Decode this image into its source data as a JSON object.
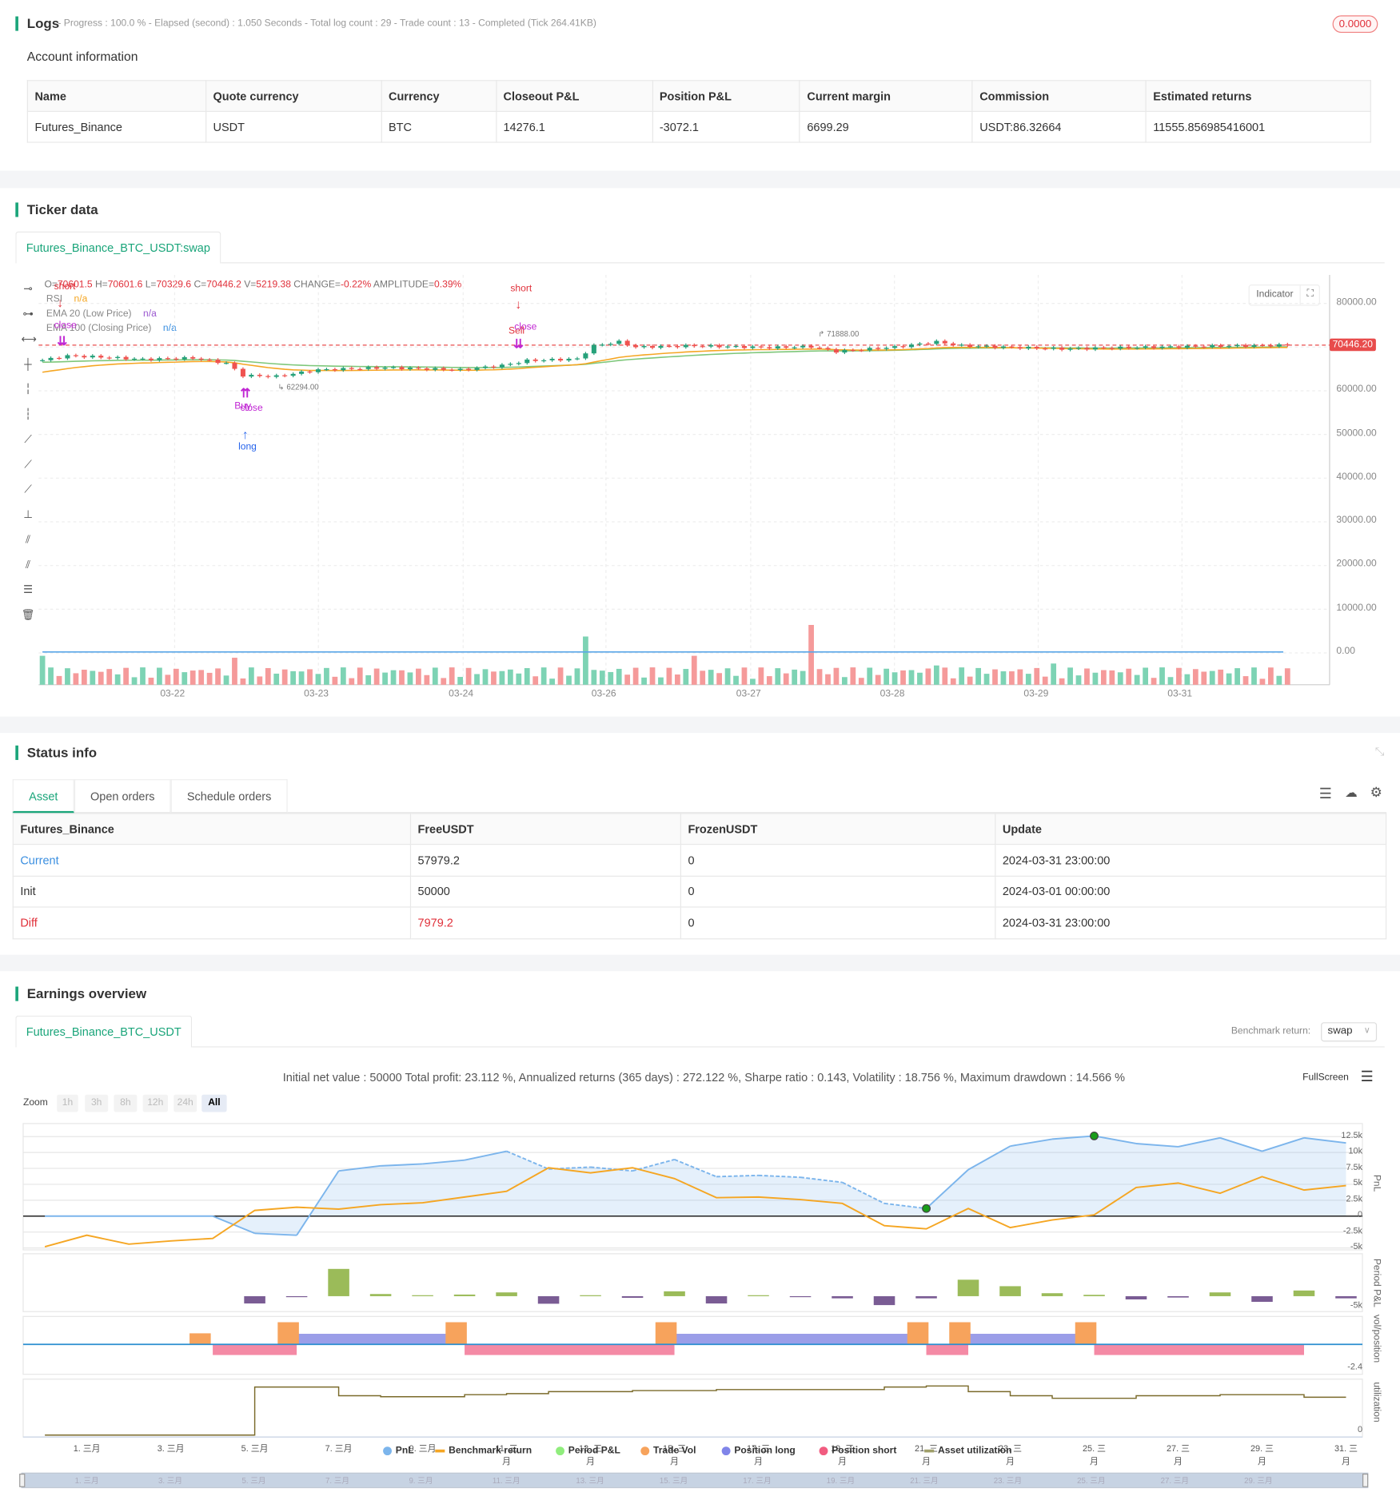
{
  "logs": {
    "title": "Logs",
    "summary": "- Progress : 100.0 % - Elapsed (second) : 1.050  Seconds - Total log count : 29 - Trade count : 13 - Completed (Tick 264.41KB)",
    "badge": "0.0000"
  },
  "account": {
    "title": "Account information",
    "headers": [
      "Name",
      "Quote currency",
      "Currency",
      "Closeout P&L",
      "Position P&L",
      "Current margin",
      "Commission",
      "Estimated returns"
    ],
    "row": [
      "Futures_Binance",
      "USDT",
      "BTC",
      "14276.1",
      "-3072.1",
      "6699.29",
      "USDT:86.32664",
      "11555.856985416001"
    ]
  },
  "ticker": {
    "title": "Ticker data",
    "tab": "Futures_Binance_BTC_USDT:swap",
    "ohlc": {
      "o_label": "O=",
      "o": "70601.5",
      "h_label": "H=",
      "h": "70601.6",
      "l_label": "L=",
      "l": "70329.6",
      "c_label": "C=",
      "c": "70446.2",
      "v_label": "V=",
      "v": "5219.38",
      "change_label": "CHANGE=",
      "change": "-0.22%",
      "amp_label": "AMPLITUDE=",
      "amp": "0.39%"
    },
    "indicators": [
      {
        "name": "RSI",
        "value": "n/a",
        "color": "#f5a623"
      },
      {
        "name": "EMA 20 (Low Price)",
        "value": "n/a",
        "color": "#9b59d0"
      },
      {
        "name": "EMA 100 (Closing Price)",
        "value": "n/a",
        "color": "#3b8fe0"
      }
    ],
    "indicator_button": "Indicator",
    "last_price": "70446.20",
    "high_mark": "71888.00",
    "low_mark": "62294.00",
    "yticks": [
      "80000.00",
      "60000.00",
      "50000.00",
      "40000.00",
      "30000.00",
      "20000.00",
      "10000.00",
      "0.00"
    ],
    "xticks": [
      "03-22",
      "03-23",
      "03-24",
      "03-26",
      "03-27",
      "03-28",
      "03-29",
      "03-31"
    ],
    "signals": [
      {
        "text": "short",
        "color": "#e0303a"
      },
      {
        "text": "close",
        "color": "#c026d3"
      },
      {
        "text": "Sell",
        "color": "#e0303a"
      },
      {
        "text": "short",
        "color": "#e0303a"
      },
      {
        "text": "close",
        "color": "#c026d3"
      },
      {
        "text": "Buy",
        "color": "#c026d3"
      },
      {
        "text": "close",
        "color": "#c026d3"
      },
      {
        "text": "long",
        "color": "#2563eb"
      }
    ]
  },
  "chart_data": [
    {
      "type": "candlestick",
      "title": "Futures_Binance_BTC_USDT:swap",
      "ylim": [
        0,
        85000
      ],
      "price_keyframes": [
        [
          0,
          67000
        ],
        [
          3,
          68000
        ],
        [
          6,
          67800
        ],
        [
          12,
          67200
        ],
        [
          18,
          67500
        ],
        [
          22,
          66300
        ],
        [
          24,
          63500
        ],
        [
          28,
          63300
        ],
        [
          33,
          64800
        ],
        [
          41,
          65300
        ],
        [
          50,
          64800
        ],
        [
          55,
          65800
        ],
        [
          58,
          66900
        ],
        [
          64,
          67300
        ],
        [
          66,
          70300
        ],
        [
          69,
          71200
        ],
        [
          71,
          70000
        ],
        [
          78,
          70300
        ],
        [
          87,
          69900
        ],
        [
          92,
          70100
        ],
        [
          95,
          69000
        ],
        [
          102,
          70000
        ],
        [
          107,
          71200
        ],
        [
          110,
          70300
        ],
        [
          122,
          69600
        ],
        [
          133,
          70000
        ],
        [
          149,
          70446.2
        ]
      ],
      "candle_count": 150,
      "volume_spikes": [
        [
          0,
          30
        ],
        [
          23,
          28
        ],
        [
          65,
          50
        ],
        [
          78,
          30
        ],
        [
          92,
          62
        ],
        [
          107,
          20
        ],
        [
          121,
          22
        ]
      ]
    },
    {
      "type": "line",
      "title": "PnL",
      "yticks": [
        "12.5k",
        "10k",
        "7.5k",
        "5k",
        "2.5k",
        "0",
        "-2.5k",
        "-5k"
      ],
      "ylim": [
        -5,
        12.5
      ],
      "x_days": [
        0,
        4,
        5,
        6,
        7,
        8,
        9,
        10,
        11,
        12,
        13,
        14,
        15,
        16,
        17,
        18,
        19,
        20,
        21,
        22,
        23,
        24,
        25,
        26,
        27,
        28,
        29,
        30,
        31
      ],
      "pnl_k": [
        0,
        0,
        -2.7,
        -3.0,
        7.1,
        7.9,
        8.2,
        8.8,
        10.2,
        7.4,
        7.7,
        7.1,
        8.9,
        6.2,
        6.4,
        6.1,
        5.3,
        2.0,
        1.2,
        7.3,
        11.0,
        12.1,
        12.6,
        11.4,
        10.9,
        12.3,
        10.2,
        12.3,
        11.5
      ],
      "drawdown_days": [
        11,
        21
      ],
      "markers_days": [
        21,
        25
      ],
      "benchmark_days": [
        0,
        1,
        2,
        3,
        4,
        5,
        6,
        7,
        8,
        9,
        10,
        11,
        12,
        13,
        14,
        15,
        16,
        17,
        18,
        19,
        20,
        21,
        22,
        23,
        24,
        25,
        26,
        27,
        28,
        29,
        30,
        31
      ],
      "benchmark_k": [
        -4.8,
        -3.0,
        -4.4,
        -3.9,
        -3.5,
        0.9,
        1.4,
        1.1,
        1.8,
        2.1,
        3.0,
        3.9,
        7.6,
        6.8,
        7.6,
        5.9,
        2.9,
        3.0,
        2.6,
        2.0,
        -1.5,
        -2.0,
        1.2,
        -1.8,
        -0.6,
        0.2,
        4.5,
        5.2,
        3.6,
        6.2,
        4.1,
        4.8
      ]
    },
    {
      "type": "bar",
      "title": "Period P&L",
      "ytick": "-5k",
      "start_day": 5,
      "values_k": [
        -2.7,
        -0.3,
        10.1,
        0.8,
        0.3,
        0.6,
        1.4,
        -2.8,
        0.3,
        -0.6,
        1.8,
        -2.7,
        0.2,
        -0.3,
        -0.8,
        -3.3,
        -0.8,
        6.1,
        3.7,
        1.1,
        0.5,
        -1.2,
        -0.5,
        1.4,
        -2.1,
        2.1,
        -0.8
      ]
    },
    {
      "type": "bar",
      "title": "vol/position",
      "ytick": "-2.4",
      "trade_vol": [
        [
          3.7,
          1
        ],
        [
          5.8,
          2
        ],
        [
          9.8,
          2
        ],
        [
          14.8,
          2
        ],
        [
          20.8,
          2
        ],
        [
          21.8,
          2
        ],
        [
          24.8,
          2
        ]
      ],
      "position_long": [
        [
          6,
          9.8
        ],
        [
          15,
          20.8
        ],
        [
          22,
          24.8
        ]
      ],
      "position_short": [
        [
          4,
          6
        ],
        [
          10,
          15
        ],
        [
          21,
          22
        ],
        [
          25,
          30
        ]
      ]
    },
    {
      "type": "line",
      "title": "utilization",
      "ytick": "0",
      "step_days": [
        5,
        7,
        8,
        10,
        11,
        12,
        14,
        16,
        18,
        20,
        21,
        22,
        23,
        24,
        26,
        28,
        30,
        31
      ],
      "values": [
        0.94,
        0.77,
        0.75,
        0.79,
        0.81,
        0.85,
        0.87,
        0.89,
        0.89,
        0.94,
        0.96,
        0.85,
        0.77,
        0.72,
        0.77,
        0.79,
        0.74,
        0.74
      ]
    }
  ],
  "status": {
    "title": "Status info",
    "tabs": [
      "Asset",
      "Open orders",
      "Schedule orders"
    ],
    "headers": [
      "Futures_Binance",
      "FreeUSDT",
      "FrozenUSDT",
      "Update"
    ],
    "rows": [
      [
        "Current",
        "57979.2",
        "0",
        "2024-03-31 23:00:00"
      ],
      [
        "Init",
        "50000",
        "0",
        "2024-03-01 00:00:00"
      ],
      [
        "Diff",
        "7979.2",
        "0",
        "2024-03-31 23:00:00"
      ]
    ]
  },
  "earnings": {
    "title": "Earnings overview",
    "tab": "Futures_Binance_BTC_USDT",
    "benchmark_label": "Benchmark return:",
    "benchmark_value": "swap",
    "summary": "Initial net value : 50000 Total profit: 23.112 %, Annualized returns (365 days) : 272.122 %, Sharpe ratio : 0.143, Volatility : 18.756 %, Maximum drawdown : 14.566 %",
    "fullscreen": "FullScreen",
    "zoom_label": "Zoom",
    "zoom": [
      "1h",
      "3h",
      "8h",
      "12h",
      "24h",
      "All"
    ],
    "axis_titles": [
      "PnL",
      "Period P&L",
      "vol/position",
      "utilization"
    ],
    "xticks": [
      "1. 三月",
      "3. 三月",
      "5. 三月",
      "7. 三月",
      "9. 三月",
      "11. 三月",
      "13. 三月",
      "15. 三月",
      "17. 三月",
      "19. 三月",
      "21. 三月",
      "23. 三月",
      "25. 三月",
      "27. 三月",
      "29. 三月",
      "31. 三月"
    ],
    "navigator_ticks": [
      "1. 三月",
      "3. 三月",
      "5. 三月",
      "7. 三月",
      "9. 三月",
      "11. 三月",
      "13. 三月",
      "15. 三月",
      "17. 三月",
      "19. 三月",
      "21. 三月",
      "23. 三月",
      "25. 三月",
      "27. 三月",
      "29. 三月"
    ],
    "legend": [
      {
        "label": "PnL",
        "color": "#7cb5ec"
      },
      {
        "label": "Benchmark return",
        "color": "#f5a623"
      },
      {
        "label": "Period P&L",
        "color": "#90ed7d"
      },
      {
        "label": "Trade Vol",
        "color": "#f7a35c"
      },
      {
        "label": "Position long",
        "color": "#8085e9"
      },
      {
        "label": "Position short",
        "color": "#f15c80"
      },
      {
        "label": "Asset utilization",
        "color": "#a09f6a"
      }
    ]
  }
}
